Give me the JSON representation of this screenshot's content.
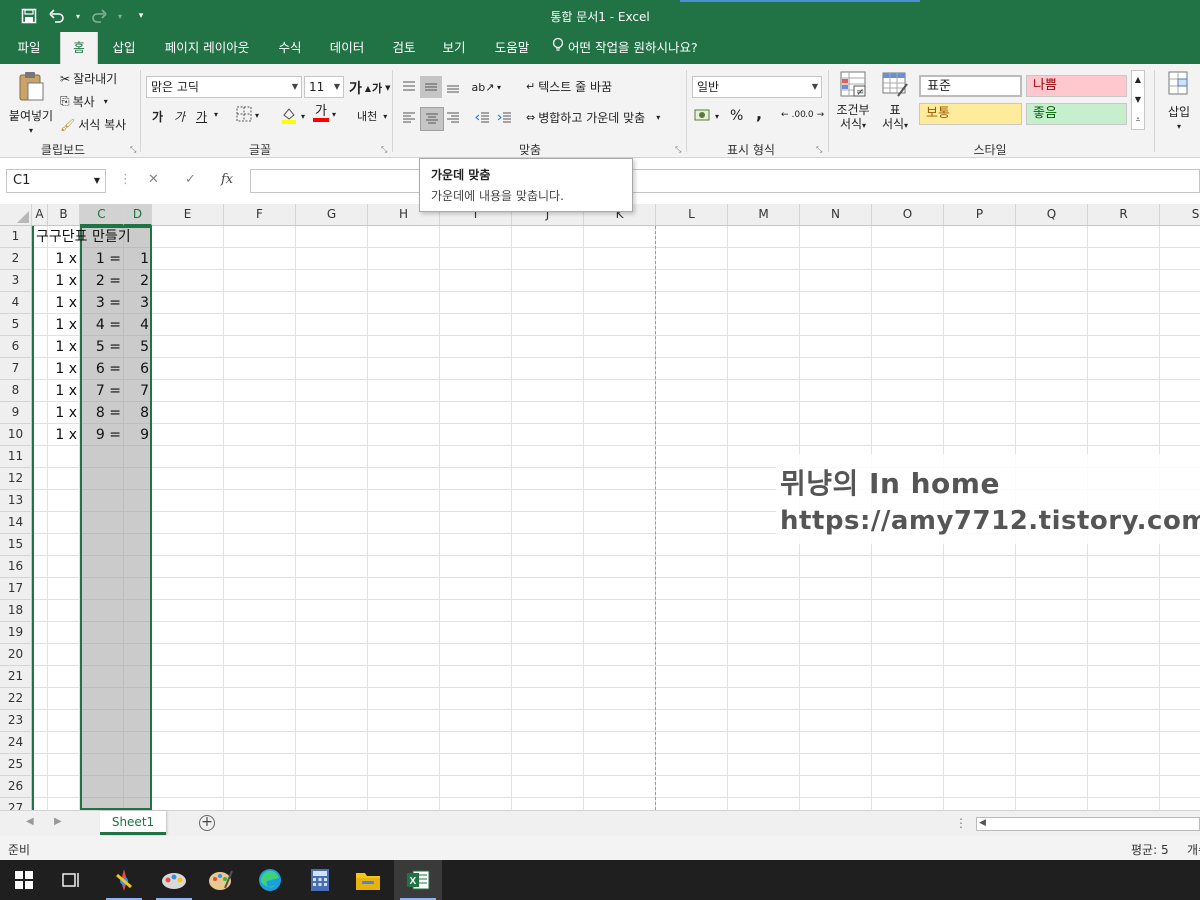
{
  "titlebar": {
    "title": "통합 문서1  -  Excel",
    "save_icon": "save-icon",
    "undo_icon": "undo-icon",
    "redo_icon": "redo-icon",
    "customize_icon": "customize-qat-icon",
    "bar_color": "#217346"
  },
  "tabs": {
    "file": "파일",
    "home": "홈",
    "insert": "삽입",
    "page_layout": "페이지 레이아웃",
    "formulas": "수식",
    "data": "데이터",
    "review": "검토",
    "view": "보기",
    "help": "도움말",
    "tell_me": "어떤 작업을 원하시나요?"
  },
  "ribbon": {
    "clipboard": {
      "paste": "붙여넣기",
      "cut": "잘라내기",
      "copy": "복사",
      "format_painter": "서식 복사",
      "label": "클립보드"
    },
    "font": {
      "font_name": "맑은 고딕",
      "font_size": "11",
      "grow": "가",
      "shrink": "가",
      "bold": "가",
      "italic": "가",
      "underline": "가",
      "font_color_glyph": "가",
      "phonetic": "내천",
      "label": "글꼴"
    },
    "alignment": {
      "wrap_text": "텍스트 줄 바꿈",
      "merge_center": "병합하고 가운데 맞춤",
      "label": "맞춤"
    },
    "number": {
      "format": "일반",
      "percent": "%",
      "comma": ",",
      "inc_decimal": ".00",
      "dec_decimal": ".0",
      "label": "표시 형식"
    },
    "styles": {
      "conditional_1": "조건부",
      "conditional_2": "서식",
      "table_1": "표",
      "table_2": "서식",
      "normal": "표준",
      "bad": "나쁨",
      "neutral": "보통",
      "good": "좋음",
      "label": "스타일",
      "bad_bg": "#ffc7ce",
      "neutral_bg": "#ffeb9c",
      "good_bg": "#c6efce"
    },
    "cells": {
      "insert": "삽입"
    }
  },
  "formula_bar": {
    "name_box": "C1",
    "cancel": "✕",
    "enter": "✓",
    "fx": "fx",
    "formula": ""
  },
  "tooltip": {
    "title": "가운데 맞춤",
    "description": "가운데에 내용을 맞춥니다."
  },
  "grid": {
    "columns": [
      "A",
      "B",
      "C",
      "D",
      "E",
      "F",
      "G",
      "H",
      "I",
      "J",
      "K",
      "L",
      "M",
      "N",
      "O",
      "P",
      "Q",
      "R",
      "S"
    ],
    "rows": [
      "1",
      "2",
      "3",
      "4",
      "5",
      "6",
      "7",
      "8",
      "9",
      "10",
      "11",
      "12",
      "13",
      "14",
      "15",
      "16",
      "17",
      "18",
      "19",
      "20",
      "21",
      "22",
      "23",
      "24",
      "25",
      "26",
      "27"
    ],
    "a1_title": "구구단표 만들기",
    "data_rows": [
      {
        "b": "1 x",
        "c": "1 =",
        "d": "1"
      },
      {
        "b": "1 x",
        "c": "2 =",
        "d": "2"
      },
      {
        "b": "1 x",
        "c": "3 =",
        "d": "3"
      },
      {
        "b": "1 x",
        "c": "4 =",
        "d": "4"
      },
      {
        "b": "1 x",
        "c": "5 =",
        "d": "5"
      },
      {
        "b": "1 x",
        "c": "6 =",
        "d": "6"
      },
      {
        "b": "1 x",
        "c": "7 =",
        "d": "7"
      },
      {
        "b": "1 x",
        "c": "8 =",
        "d": "8"
      },
      {
        "b": "1 x",
        "c": "9 =",
        "d": "9"
      }
    ],
    "selected_columns": [
      "C",
      "D"
    ]
  },
  "watermark": {
    "line1": "뮈냥의 In home",
    "line2": "https://amy7712.tistory.com"
  },
  "sheets": {
    "active": "Sheet1",
    "add_icon": "add-sheet-icon"
  },
  "status": {
    "ready": "준비",
    "average": "평균: 5",
    "count": "개수"
  },
  "taskbar": {
    "items": [
      "windows-start-icon",
      "task-view-icon",
      "paint-app-icon",
      "paint3d-icon",
      "palette-app-icon",
      "edge-icon",
      "calculator-icon",
      "file-explorer-icon",
      "excel-icon"
    ]
  }
}
